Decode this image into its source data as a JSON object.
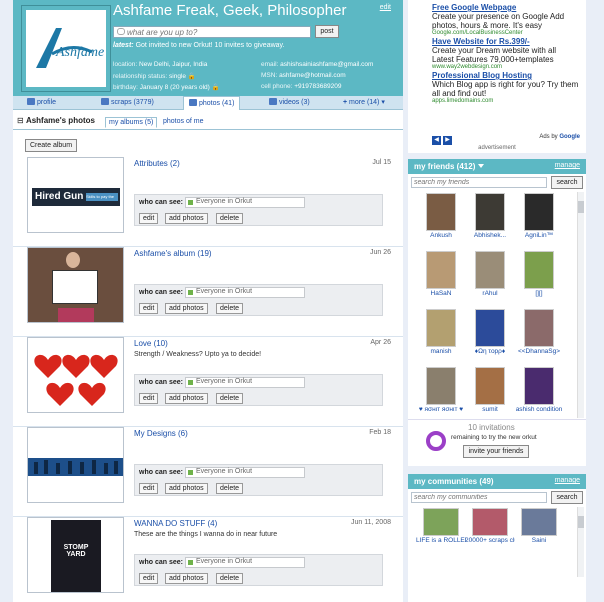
{
  "profile": {
    "name": "Ashfame Freak, Geek, Philosopher",
    "edit_label": "edit",
    "status_placeholder": "what are you up to?",
    "post_label": "post",
    "latest_label": "latest:",
    "latest_text": "Got invited to new Orkut! 10 invites to giveaway.",
    "logo_text": "Ashfame",
    "location_label": "location:",
    "location": "New Delhi, Jaipur, India",
    "relationship_label": "relationship status:",
    "relationship": "single",
    "birthday_label": "birthday:",
    "birthday": "January 8 (20 years old)",
    "email_label": "email:",
    "email": "ashishsainiashfame@gmail.com",
    "msn_label": "MSN:",
    "msn": "ashfame@hotmail.com",
    "cell_label": "cell phone:",
    "cell": "+919783689209"
  },
  "tabs": [
    {
      "label": "profile"
    },
    {
      "label": "scraps (3779)"
    },
    {
      "label": "photos (41)"
    },
    {
      "label": "videos (3)"
    },
    {
      "label": "more (14)"
    }
  ],
  "albums_section": {
    "title": "Ashfame's photos",
    "my_albums": "my albums (5)",
    "photos_of_me": "photos of me",
    "create_album": "Create album",
    "who_can_see": "who can see:",
    "edit": "edit",
    "add_photos": "add photos",
    "delete": "delete"
  },
  "albums": [
    {
      "name": "Attributes (2)",
      "date": "Jul 15",
      "desc": "",
      "visibility": "Everyone in Orkut",
      "thumb_text": "Hired Gun",
      "thumb_sub": "Skills to pay the bills"
    },
    {
      "name": "Ashfame's album (19)",
      "date": "Jun 26",
      "desc": "",
      "visibility": "Everyone in Orkut"
    },
    {
      "name": "Love (10)",
      "date": "Apr 26",
      "desc": "Strength / Weakness? Upto ya to decide!",
      "visibility": "Everyone in Orkut"
    },
    {
      "name": "My Designs (6)",
      "date": "Feb 18",
      "desc": "",
      "visibility": "Everyone in Orkut"
    },
    {
      "name": "WANNA DO STUFF (4)",
      "date": "Jun 11, 2008",
      "desc": "These are the things I wanna do in near future",
      "visibility": "Everyone in Orkut",
      "thumb_text": "STOMP YARD"
    }
  ],
  "ads": [
    {
      "title": "Free Google Webpage",
      "text": "Create your presence on Google Add photos, hours & more. It's easy",
      "url": "Google.com/LocalBusinessCenter"
    },
    {
      "title": "Have Website for Rs.399/-",
      "text": "Create your Dream website with all Latest Features 79,000+templates",
      "url": "www.way2webdesign.com"
    },
    {
      "title": "Professional Blog Hosting",
      "text": "Which Blog app is right for you? Try them all and find out!",
      "url": "apps.limedomains.com"
    }
  ],
  "ads_meta": {
    "ads_by": "Ads by",
    "google": "Google",
    "advertisement": "advertisement"
  },
  "friends_box": {
    "title": "my friends (412)",
    "manage": "manage",
    "search_placeholder": "search my friends",
    "search_btn": "search",
    "friends": [
      {
        "name": "Ankush",
        "color": "#7a5c44"
      },
      {
        "name": "Abhishek...",
        "color": "#3d3a34"
      },
      {
        "name": "AgniLin™",
        "color": "#2a2a2a"
      },
      {
        "name": "HaSaN",
        "color": "#b89a74"
      },
      {
        "name": "rAhul",
        "color": "#9a8d78"
      },
      {
        "name": "[][]",
        "color": "#7c9f4c"
      },
      {
        "name": "manish",
        "color": "#b3a070"
      },
      {
        "name": "♦Ωη τopρ♦",
        "color": "#2c4b9a"
      },
      {
        "name": "<<DhannaSg>",
        "color": "#8b6a6a"
      },
      {
        "name": "♥ яσнιт яσнιт ♥",
        "color": "#8a7f6d"
      },
      {
        "name": "sumit",
        "color": "#a46f45"
      },
      {
        "name": "ashish condition",
        "color": "#4a2b6e"
      }
    ]
  },
  "invite": {
    "count": "10 invitations",
    "sub": "remaining to try the new orkut",
    "button": "invite your friends"
  },
  "communities_box": {
    "title": "my communities (49)",
    "manage": "manage",
    "search_placeholder": "search my communities",
    "search_btn": "search",
    "communities": [
      {
        "name": "LIFE is a ROLLERCOAS",
        "color": "#7da35a"
      },
      {
        "name": "20000+ scraps club™",
        "color": "#b35a6a"
      },
      {
        "name": "Saini",
        "color": "#6a7a9a"
      }
    ]
  },
  "colors": {
    "header_teal": "#5cb8c4",
    "link_blue": "#1b4fa8"
  }
}
